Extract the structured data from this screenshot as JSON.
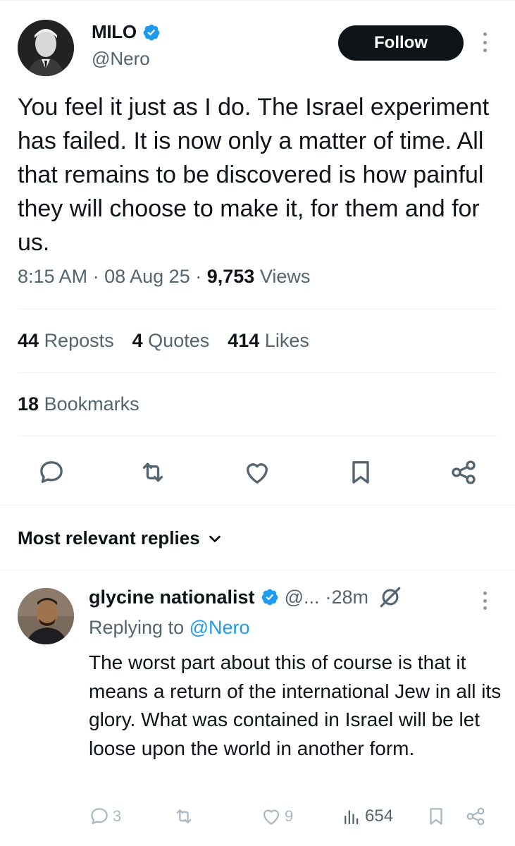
{
  "tweet": {
    "author_name": "MILO",
    "author_handle": "@Nero",
    "follow_label": "Follow",
    "text": "You feel it just as I do. The Israel experiment has failed. It is now only a matter of time. All that remains to be discovered is how painful they will choose to make it, for them and for us.",
    "time": "8:15 AM",
    "separator": "·",
    "date": "08 Aug 25",
    "views_count": "9,753",
    "views_label": "Views",
    "reposts_count": "44",
    "reposts_label": "Reposts",
    "quotes_count": "4",
    "quotes_label": "Quotes",
    "likes_count": "414",
    "likes_label": "Likes",
    "bookmarks_count": "18",
    "bookmarks_label": "Bookmarks"
  },
  "actions": {
    "icons": [
      "reply-icon",
      "retweet-icon",
      "like-icon",
      "bookmark-icon",
      "share-icon"
    ]
  },
  "replies_header": {
    "label": "Most relevant replies"
  },
  "reply": {
    "author_name": "glycine nationalist",
    "author_handle": "@...",
    "time": "·28m",
    "replying_prefix": "Replying to",
    "replying_to": "@Nero",
    "text": "The worst part about this of course is that it means a return of the international Jew in all its glory. What was contained in Israel will be let loose upon the world in another form.",
    "reply_count": "3",
    "like_count": "9",
    "view_count": "654"
  },
  "colors": {
    "verified": "#1d9bf0",
    "link": "#1d9bf0",
    "secondary_text": "#536471",
    "follow_button": "#0f1419",
    "divider": "#eff3f4"
  }
}
